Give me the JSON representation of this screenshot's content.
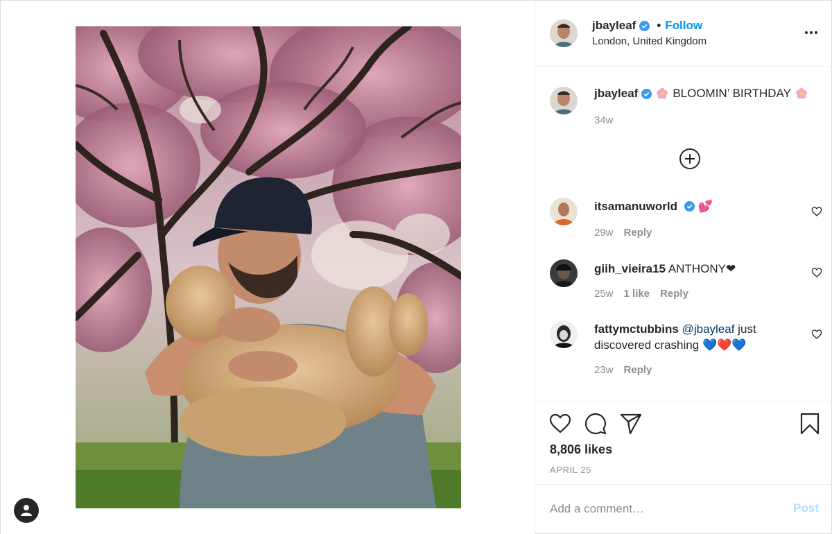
{
  "post": {
    "author": "jbayleaf",
    "follow_label": "Follow",
    "location": "London, United Kingdom",
    "dot": "•",
    "photo_alt": "",
    "caption": {
      "username": "jbayleaf",
      "text": "BLOOMIN’ BIRTHDAY",
      "time": "34w"
    },
    "likes": "8,806 likes",
    "date": "APRIL 25"
  },
  "comments": [
    {
      "username": "itsamanuworld",
      "verified": true,
      "text": "",
      "emoji": "💕",
      "time": "29w",
      "likes": "",
      "reply_label": "Reply"
    },
    {
      "username": "giih_vieira15",
      "verified": false,
      "text": "ANTHONY",
      "emoji": "❤",
      "time": "25w",
      "likes": "1 like",
      "reply_label": "Reply"
    },
    {
      "username": "fattymctubbins",
      "verified": false,
      "mention": "@jbayleaf",
      "text": "just discovered crashing",
      "emoji": "💙❤️💙",
      "time": "23w",
      "likes": "",
      "reply_label": "Reply"
    }
  ],
  "add_comment": {
    "placeholder": "Add a comment…",
    "post_label": "Post"
  },
  "colors": {
    "accent": "#0095f6",
    "verified": "#3897f0",
    "muted": "#8e8e8e",
    "post_disabled": "#b2dffc"
  },
  "icons": [
    "user-icon",
    "more-options-icon",
    "verified-icon",
    "flower-icon",
    "add-circle-icon",
    "heart-icon",
    "comment-icon",
    "share-icon",
    "bookmark-icon"
  ]
}
